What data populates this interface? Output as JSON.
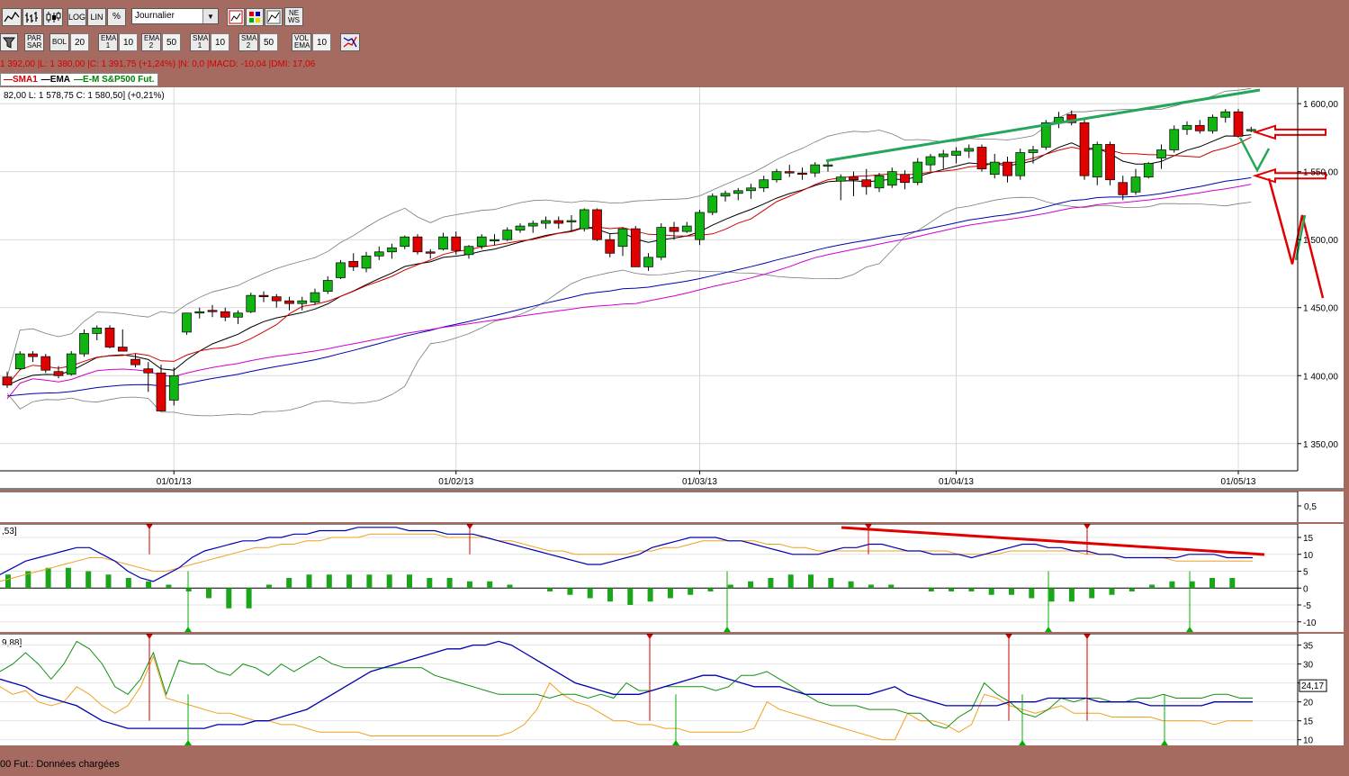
{
  "toolbar1": {
    "buttons": [
      {
        "name": "line-chart-icon",
        "label": ""
      },
      {
        "name": "bar-chart-icon",
        "label": ""
      },
      {
        "name": "candlestick-icon",
        "label": ""
      },
      {
        "name": "log-button",
        "label": "LOG"
      },
      {
        "name": "lin-button",
        "label": "LIN"
      },
      {
        "name": "percent-button",
        "label": "%"
      }
    ],
    "period_value": "Journalier",
    "tool_icons": [
      "compare-icon",
      "color-grid-icon",
      "small-chart-icon",
      "news-icon"
    ],
    "news_label": "NE WS"
  },
  "toolbar2": {
    "indicators": [
      {
        "label": "PAR SAR",
        "value": ""
      },
      {
        "label": "BOL",
        "value": "20"
      },
      {
        "label": "EMA 1",
        "value": "10"
      },
      {
        "label": "EMA 2",
        "value": "50"
      },
      {
        "label": "SMA 1",
        "value": "10"
      },
      {
        "label": "SMA 2",
        "value": "50"
      },
      {
        "label": "VOL EMA",
        "value": "10"
      }
    ]
  },
  "info": {
    "ohlc_line": "1 392,00 |L: 1 380,00 |C: 1 391,75 (+1,24%) |N: 0,0 |MACD: -10,04 |DMI: 17,06",
    "legend": [
      {
        "label": "SMA1",
        "color": "#d20000"
      },
      {
        "label": "EMA",
        "color": "#000000"
      },
      {
        "label": "E-M S&P500 Fut.",
        "color": "#008000"
      }
    ],
    "quote_line": "82,00  L: 1 578,75  C: 1 580,50] (+0,21%)"
  },
  "chart_data": [
    {
      "type": "candlestick",
      "title": "",
      "ylim": [
        1330,
        1612
      ],
      "y_ticks": [
        "1 600,00",
        "1 550,00",
        "1 500,00",
        "1 450,00",
        "1 400,00",
        "1 350,00"
      ],
      "x_ticks": [
        "01/01/13",
        "01/02/13",
        "01/03/13",
        "01/04/13",
        "01/05/13"
      ],
      "candles": [
        [
          1399,
          1403,
          1391,
          1393
        ],
        [
          1405,
          1418,
          1404,
          1416
        ],
        [
          1416,
          1418,
          1410,
          1414
        ],
        [
          1414,
          1416,
          1402,
          1404
        ],
        [
          1403,
          1407,
          1398,
          1400
        ],
        [
          1401,
          1418,
          1400,
          1416
        ],
        [
          1416,
          1434,
          1414,
          1431
        ],
        [
          1431,
          1437,
          1426,
          1435
        ],
        [
          1435,
          1437,
          1420,
          1421
        ],
        [
          1421,
          1434,
          1418,
          1418
        ],
        [
          1412,
          1416,
          1406,
          1408
        ],
        [
          1405,
          1410,
          1388,
          1402
        ],
        [
          1402,
          1408,
          1375,
          1374
        ],
        [
          1382,
          1406,
          1378,
          1400
        ],
        [
          1432,
          1446,
          1430,
          1446
        ],
        [
          1446,
          1450,
          1442,
          1447
        ],
        [
          1448,
          1452,
          1443,
          1447
        ],
        [
          1447,
          1450,
          1440,
          1443
        ],
        [
          1443,
          1448,
          1438,
          1446
        ],
        [
          1447,
          1461,
          1446,
          1459
        ],
        [
          1459,
          1462,
          1454,
          1458
        ],
        [
          1458,
          1460,
          1450,
          1455
        ],
        [
          1455,
          1458,
          1448,
          1453
        ],
        [
          1453,
          1458,
          1448,
          1455
        ],
        [
          1454,
          1464,
          1452,
          1461
        ],
        [
          1462,
          1473,
          1460,
          1470
        ],
        [
          1472,
          1485,
          1471,
          1483
        ],
        [
          1484,
          1490,
          1477,
          1480
        ],
        [
          1479,
          1491,
          1476,
          1488
        ],
        [
          1488,
          1495,
          1485,
          1491
        ],
        [
          1491,
          1497,
          1486,
          1494
        ],
        [
          1495,
          1503,
          1493,
          1502
        ],
        [
          1502,
          1504,
          1489,
          1491
        ],
        [
          1491,
          1493,
          1486,
          1490
        ],
        [
          1493,
          1505,
          1492,
          1502
        ],
        [
          1502,
          1506,
          1489,
          1492
        ],
        [
          1489,
          1496,
          1486,
          1495
        ],
        [
          1495,
          1504,
          1493,
          1502
        ],
        [
          1500,
          1504,
          1496,
          1500
        ],
        [
          1500,
          1509,
          1499,
          1507
        ],
        [
          1507,
          1512,
          1505,
          1510
        ],
        [
          1510,
          1514,
          1505,
          1512
        ],
        [
          1512,
          1517,
          1508,
          1514
        ],
        [
          1514,
          1517,
          1508,
          1512
        ],
        [
          1514,
          1518,
          1506,
          1514
        ],
        [
          1508,
          1523,
          1506,
          1522
        ],
        [
          1522,
          1523,
          1499,
          1500
        ],
        [
          1500,
          1504,
          1487,
          1490
        ],
        [
          1495,
          1509,
          1488,
          1508
        ],
        [
          1508,
          1510,
          1480,
          1480
        ],
        [
          1480,
          1490,
          1477,
          1487
        ],
        [
          1487,
          1512,
          1485,
          1509
        ],
        [
          1509,
          1513,
          1500,
          1506
        ],
        [
          1506,
          1513,
          1505,
          1510
        ],
        [
          1500,
          1522,
          1496,
          1520
        ],
        [
          1520,
          1534,
          1518,
          1532
        ],
        [
          1532,
          1536,
          1528,
          1534
        ],
        [
          1534,
          1538,
          1529,
          1536
        ],
        [
          1536,
          1541,
          1530,
          1538
        ],
        [
          1538,
          1547,
          1535,
          1544
        ],
        [
          1544,
          1552,
          1542,
          1550
        ],
        [
          1550,
          1555,
          1546,
          1549
        ],
        [
          1549,
          1553,
          1544,
          1548
        ],
        [
          1549,
          1557,
          1546,
          1555
        ],
        [
          1555,
          1559,
          1550,
          1555
        ],
        [
          1543,
          1548,
          1529,
          1546
        ],
        [
          1546,
          1550,
          1532,
          1544
        ],
        [
          1544,
          1552,
          1533,
          1539
        ],
        [
          1538,
          1549,
          1535,
          1547
        ],
        [
          1540,
          1553,
          1538,
          1550
        ],
        [
          1548,
          1551,
          1537,
          1542
        ],
        [
          1542,
          1560,
          1540,
          1557
        ],
        [
          1555,
          1563,
          1550,
          1561
        ],
        [
          1561,
          1566,
          1552,
          1563
        ],
        [
          1562,
          1568,
          1556,
          1565
        ],
        [
          1565,
          1570,
          1560,
          1567
        ],
        [
          1568,
          1570,
          1550,
          1552
        ],
        [
          1548,
          1563,
          1545,
          1557
        ],
        [
          1557,
          1561,
          1542,
          1547
        ],
        [
          1547,
          1567,
          1544,
          1564
        ],
        [
          1564,
          1569,
          1556,
          1566
        ],
        [
          1568,
          1588,
          1566,
          1586
        ],
        [
          1586,
          1594,
          1582,
          1590
        ],
        [
          1592,
          1595,
          1584,
          1586
        ],
        [
          1586,
          1588,
          1544,
          1547
        ],
        [
          1546,
          1572,
          1540,
          1570
        ],
        [
          1570,
          1572,
          1540,
          1544
        ],
        [
          1542,
          1547,
          1529,
          1533
        ],
        [
          1535,
          1552,
          1533,
          1546
        ],
        [
          1546,
          1557,
          1545,
          1556
        ],
        [
          1560,
          1570,
          1552,
          1566
        ],
        [
          1566,
          1584,
          1564,
          1581
        ],
        [
          1581,
          1587,
          1577,
          1584
        ],
        [
          1584,
          1588,
          1578,
          1580
        ],
        [
          1580,
          1592,
          1578,
          1590
        ],
        [
          1590,
          1596,
          1586,
          1594
        ],
        [
          1594,
          1596,
          1575,
          1576
        ],
        [
          1580,
          1583,
          1579,
          1581
        ]
      ],
      "hand_drawn_trendlines": [
        "green-resistance-line",
        "red-arrow-pointers",
        "red-green-projection-path"
      ]
    },
    {
      "type": "line",
      "title": "",
      "label": "0,5",
      "y_ticks": [
        "0,5"
      ]
    },
    {
      "type": "line",
      "title": "",
      "header_value": ",53]",
      "y_ticks": [
        "15",
        "10",
        "5",
        "0",
        "-5",
        "-10"
      ],
      "ylim": [
        -13,
        19
      ],
      "series": [
        {
          "values": [
            4,
            6,
            8,
            9,
            10,
            11,
            12,
            12,
            10,
            8,
            5,
            3,
            2,
            4,
            6,
            9,
            11,
            12,
            13,
            14,
            14,
            15,
            15,
            16,
            16,
            17,
            17,
            17,
            18,
            18,
            18,
            18,
            17,
            17,
            17,
            16,
            16,
            16,
            15,
            14,
            13,
            12,
            11,
            10,
            9,
            8,
            7,
            7,
            8,
            9,
            10,
            12,
            13,
            14,
            15,
            15,
            15,
            14,
            14,
            13,
            12,
            11,
            10,
            10,
            10,
            11,
            12,
            12,
            13,
            13,
            12,
            11,
            11,
            10,
            10,
            10,
            9,
            10,
            11,
            12,
            13,
            13,
            12,
            12,
            11,
            11,
            10,
            10,
            9,
            9,
            9,
            9,
            9,
            10,
            10,
            10,
            9,
            9,
            9
          ]
        },
        {
          "values": [
            2,
            3,
            4,
            5,
            6,
            7,
            8,
            9,
            9,
            8,
            7,
            6,
            5,
            5,
            6,
            7,
            8,
            9,
            10,
            11,
            12,
            12,
            13,
            13,
            14,
            14,
            15,
            15,
            15,
            16,
            16,
            16,
            16,
            16,
            16,
            15,
            15,
            15,
            15,
            14,
            14,
            13,
            12,
            11,
            11,
            10,
            10,
            10,
            10,
            10,
            11,
            11,
            12,
            12,
            13,
            14,
            14,
            14,
            14,
            14,
            13,
            13,
            12,
            12,
            11,
            11,
            11,
            11,
            11,
            11,
            11,
            11,
            11,
            11,
            11,
            10,
            10,
            10,
            10,
            11,
            11,
            11,
            11,
            11,
            11,
            10,
            10,
            10,
            9,
            9,
            9,
            9,
            8,
            8,
            8,
            8,
            8,
            8,
            8
          ]
        }
      ],
      "histogram": [
        4,
        5,
        6,
        6,
        5,
        4,
        3,
        2,
        1,
        -1,
        -3,
        -6,
        -6,
        1,
        3,
        4,
        4,
        4,
        4,
        4,
        4,
        3,
        3,
        2,
        2,
        1,
        0,
        -1,
        -2,
        -3,
        -4,
        -5,
        -4,
        -3,
        -2,
        -1,
        1,
        2,
        3,
        4,
        4,
        3,
        2,
        1,
        1,
        0,
        -1,
        -1,
        -1,
        -2,
        -2,
        -3,
        -4,
        -4,
        -3,
        -2,
        -1,
        1,
        2,
        2,
        3,
        3
      ]
    },
    {
      "type": "line",
      "title": "",
      "header_value": "9,88]",
      "y_ticks": [
        "35",
        "30",
        "25",
        "20",
        "15",
        "10"
      ],
      "ylim": [
        8.5,
        38
      ],
      "current_value": "24,17"
    }
  ],
  "status": {
    "text": "00 Fut.: Données chargées"
  }
}
